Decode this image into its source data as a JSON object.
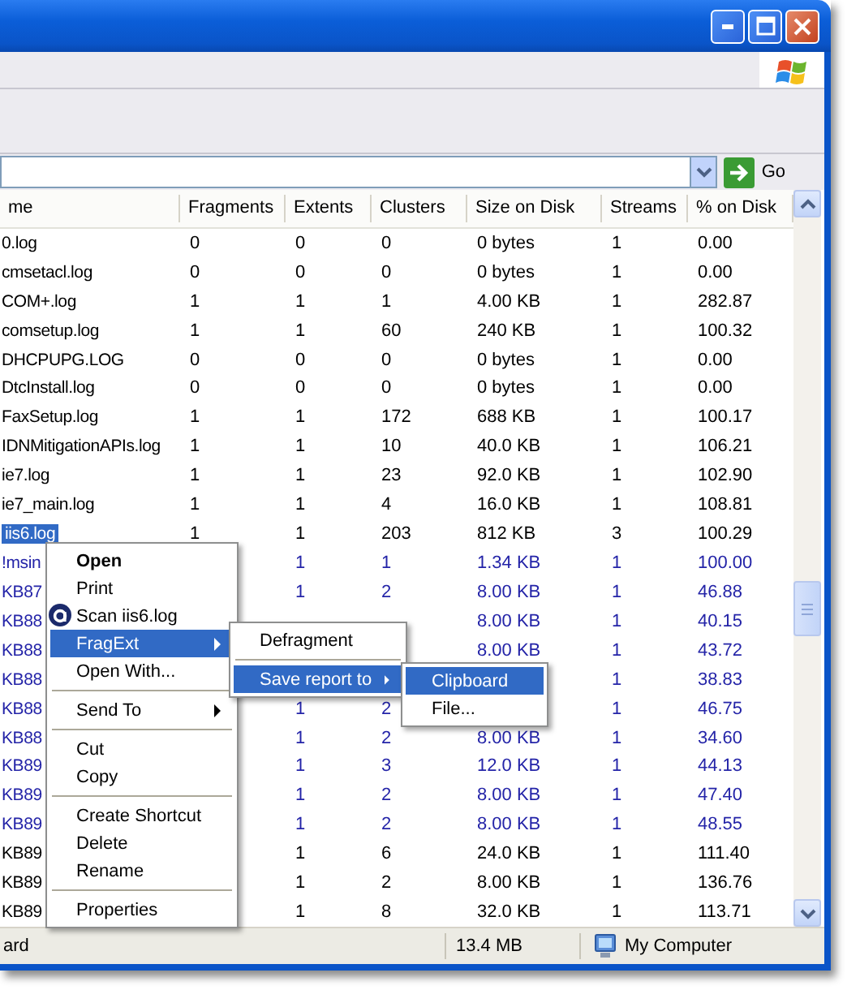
{
  "address_bar": {
    "go_label": "Go"
  },
  "table": {
    "columns": [
      "me",
      "Fragments",
      "Extents",
      "Clusters",
      "Size on Disk",
      "Streams",
      "% on Disk"
    ],
    "rows": [
      {
        "cells": [
          "0.log",
          "0",
          "0",
          "0",
          "0 bytes",
          "1",
          "0.00"
        ],
        "selected": false,
        "compressed": false
      },
      {
        "cells": [
          "cmsetacl.log",
          "0",
          "0",
          "0",
          "0 bytes",
          "1",
          "0.00"
        ],
        "selected": false,
        "compressed": false
      },
      {
        "cells": [
          "COM+.log",
          "1",
          "1",
          "1",
          "4.00 KB",
          "1",
          "282.87"
        ],
        "selected": false,
        "compressed": false
      },
      {
        "cells": [
          "comsetup.log",
          "1",
          "1",
          "60",
          "240 KB",
          "1",
          "100.32"
        ],
        "selected": false,
        "compressed": false
      },
      {
        "cells": [
          "DHCPUPG.LOG",
          "0",
          "0",
          "0",
          "0 bytes",
          "1",
          "0.00"
        ],
        "selected": false,
        "compressed": false
      },
      {
        "cells": [
          "DtcInstall.log",
          "0",
          "0",
          "0",
          "0 bytes",
          "1",
          "0.00"
        ],
        "selected": false,
        "compressed": false
      },
      {
        "cells": [
          "FaxSetup.log",
          "1",
          "1",
          "172",
          "688 KB",
          "1",
          "100.17"
        ],
        "selected": false,
        "compressed": false
      },
      {
        "cells": [
          "IDNMitigationAPIs.log",
          "1",
          "1",
          "10",
          "40.0 KB",
          "1",
          "106.21"
        ],
        "selected": false,
        "compressed": false
      },
      {
        "cells": [
          "ie7.log",
          "1",
          "1",
          "23",
          "92.0 KB",
          "1",
          "102.90"
        ],
        "selected": false,
        "compressed": false
      },
      {
        "cells": [
          "ie7_main.log",
          "1",
          "1",
          "4",
          "16.0 KB",
          "1",
          "108.81"
        ],
        "selected": false,
        "compressed": false
      },
      {
        "cells": [
          "iis6.log",
          "1",
          "1",
          "203",
          "812 KB",
          "3",
          "100.29"
        ],
        "selected": true,
        "compressed": false
      },
      {
        "cells": [
          "!msin",
          null,
          "1",
          "1",
          "1.34 KB",
          "1",
          "100.00"
        ],
        "selected": false,
        "compressed": true
      },
      {
        "cells": [
          "KB87",
          null,
          "1",
          "2",
          "8.00 KB",
          "1",
          "46.88"
        ],
        "selected": false,
        "compressed": true
      },
      {
        "cells": [
          "KB88",
          null,
          null,
          null,
          "8.00 KB",
          "1",
          "40.15"
        ],
        "selected": false,
        "compressed": true
      },
      {
        "cells": [
          "KB88",
          null,
          null,
          null,
          "8.00 KB",
          "1",
          "43.72"
        ],
        "selected": false,
        "compressed": true
      },
      {
        "cells": [
          "KB88",
          null,
          null,
          null,
          null,
          "1",
          "38.83"
        ],
        "selected": false,
        "compressed": true
      },
      {
        "cells": [
          "KB88",
          null,
          "1",
          "2",
          null,
          "1",
          "46.75"
        ],
        "selected": false,
        "compressed": true
      },
      {
        "cells": [
          "KB88",
          null,
          "1",
          "2",
          "8.00 KB",
          "1",
          "34.60"
        ],
        "selected": false,
        "compressed": true
      },
      {
        "cells": [
          "KB89",
          null,
          "1",
          "3",
          "12.0 KB",
          "1",
          "44.13"
        ],
        "selected": false,
        "compressed": true
      },
      {
        "cells": [
          "KB89",
          null,
          "1",
          "2",
          "8.00 KB",
          "1",
          "47.40"
        ],
        "selected": false,
        "compressed": true
      },
      {
        "cells": [
          "KB89",
          null,
          "1",
          "2",
          "8.00 KB",
          "1",
          "48.55"
        ],
        "selected": false,
        "compressed": true
      },
      {
        "cells": [
          "KB89",
          null,
          "1",
          "6",
          "24.0 KB",
          "1",
          "111.40"
        ],
        "selected": false,
        "compressed": false
      },
      {
        "cells": [
          "KB89",
          null,
          "1",
          "2",
          "8.00 KB",
          "1",
          "136.76"
        ],
        "selected": false,
        "compressed": false
      },
      {
        "cells": [
          "KB89",
          null,
          "1",
          "8",
          "32.0 KB",
          "1",
          "113.71"
        ],
        "selected": false,
        "compressed": false
      }
    ]
  },
  "context_menu": {
    "items": [
      {
        "kind": "item",
        "label": "Open",
        "bold": true,
        "submenu": false,
        "selected": false
      },
      {
        "kind": "item",
        "label": "Print",
        "bold": false,
        "submenu": false,
        "selected": false
      },
      {
        "kind": "scan",
        "label": "Scan iis6.log",
        "bold": false,
        "submenu": false,
        "selected": false
      },
      {
        "kind": "item",
        "label": "FragExt",
        "bold": false,
        "submenu": true,
        "selected": true
      },
      {
        "kind": "item",
        "label": "Open With...",
        "bold": false,
        "submenu": false,
        "selected": false
      },
      {
        "kind": "separator"
      },
      {
        "kind": "item",
        "label": "Send To",
        "bold": false,
        "submenu": true,
        "selected": false
      },
      {
        "kind": "separator"
      },
      {
        "kind": "item",
        "label": "Cut",
        "bold": false,
        "submenu": false,
        "selected": false
      },
      {
        "kind": "item",
        "label": "Copy",
        "bold": false,
        "submenu": false,
        "selected": false
      },
      {
        "kind": "separator"
      },
      {
        "kind": "item",
        "label": "Create Shortcut",
        "bold": false,
        "submenu": false,
        "selected": false
      },
      {
        "kind": "item",
        "label": "Delete",
        "bold": false,
        "submenu": false,
        "selected": false
      },
      {
        "kind": "item",
        "label": "Rename",
        "bold": false,
        "submenu": false,
        "selected": false
      },
      {
        "kind": "separator"
      },
      {
        "kind": "item",
        "label": "Properties",
        "bold": false,
        "submenu": false,
        "selected": false
      }
    ]
  },
  "fragext_submenu": {
    "items": [
      {
        "kind": "item",
        "label": "Defragment",
        "bold": false,
        "submenu": false,
        "selected": false
      },
      {
        "kind": "separator"
      },
      {
        "kind": "item",
        "label": "Save report to",
        "bold": false,
        "submenu": true,
        "selected": true
      }
    ]
  },
  "report_submenu": {
    "items": [
      {
        "kind": "item",
        "label": "Clipboard",
        "bold": false,
        "submenu": false,
        "selected": true
      },
      {
        "kind": "item",
        "label": "File...",
        "bold": false,
        "submenu": false,
        "selected": false
      }
    ]
  },
  "status_bar": {
    "left": "ard",
    "size": "13.4 MB",
    "zone": "My Computer"
  }
}
